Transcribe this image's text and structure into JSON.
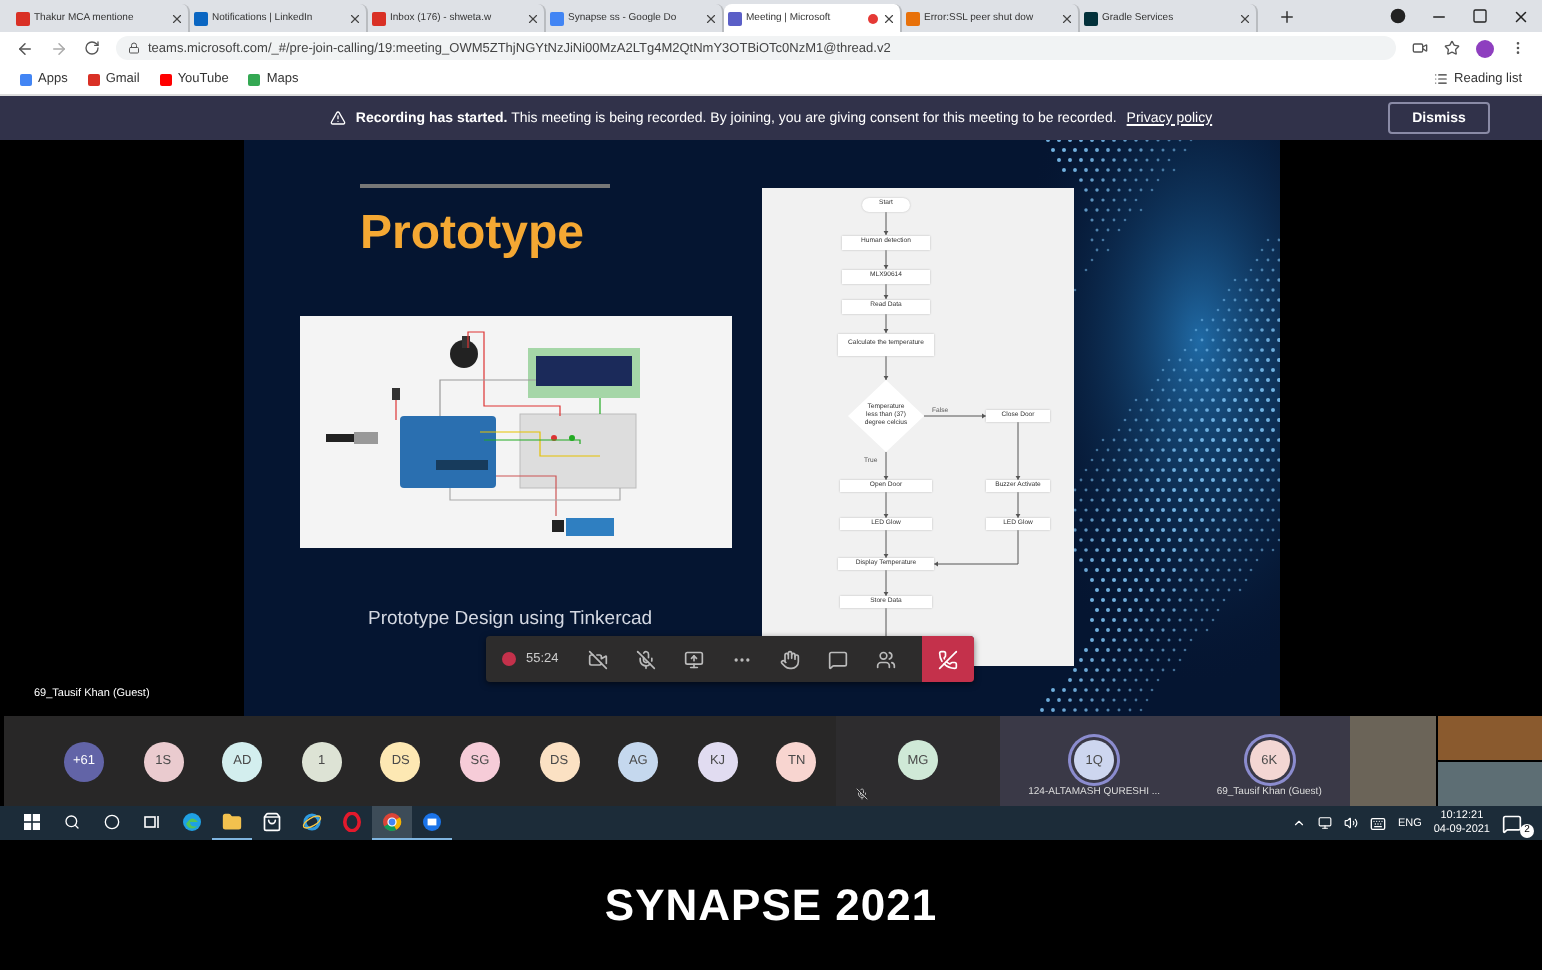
{
  "browser": {
    "tabs": [
      {
        "kind": "gmail",
        "title": "Thakur MCA mentione",
        "selected": false
      },
      {
        "kind": "linkedin",
        "title": "Notifications | LinkedIn",
        "selected": false
      },
      {
        "kind": "gmail",
        "title": "Inbox (176) - shweta.w",
        "selected": false
      },
      {
        "kind": "docs",
        "title": "Synapse ss - Google Do",
        "selected": false
      },
      {
        "kind": "teams",
        "title": "Meeting | Microsoft",
        "selected": true,
        "recording": true
      },
      {
        "kind": "error",
        "title": "Error:SSL peer shut dow",
        "selected": false
      },
      {
        "kind": "gradle",
        "title": "Gradle Services",
        "selected": false
      }
    ],
    "address": "teams.microsoft.com/_#/pre-join-calling/19:meeting_OWM5ZThjNGYtNzJiNi00MzA2LTg4M2QtNmY3OTBiOTc0NzM1@thread.v2",
    "bookmarks": [
      {
        "kind": "apps",
        "label": "Apps"
      },
      {
        "kind": "gmail",
        "label": "Gmail"
      },
      {
        "kind": "youtube",
        "label": "YouTube"
      },
      {
        "kind": "maps",
        "label": "Maps"
      }
    ],
    "reading_list": "Reading list"
  },
  "banner": {
    "text": "**Recording has started.** This meeting is being recorded. By joining, you are giving consent for this meeting to be recorded.",
    "link": "Privacy policy",
    "button": "Dismiss"
  },
  "slide": {
    "title": "Prototype",
    "caption": "Prototype Design using Tinkercad",
    "flowchart": {
      "nodes": [
        {
          "kind": "terminal",
          "label": "Start"
        },
        {
          "kind": "process",
          "label": "Human detection"
        },
        {
          "kind": "process",
          "label": "MLX90614"
        },
        {
          "kind": "process",
          "label": "Read Data"
        },
        {
          "kind": "process",
          "label": "Calculate the temperature"
        },
        {
          "kind": "decision",
          "label": "Temperature less than (37) degree celcius"
        },
        {
          "kind": "process",
          "label": "Close Door"
        },
        {
          "kind": "process",
          "label": "Open Door"
        },
        {
          "kind": "process",
          "label": "Buzzer Activate"
        },
        {
          "kind": "process",
          "label": "LED Glow"
        },
        {
          "kind": "process",
          "label": "LED Glow"
        },
        {
          "kind": "process",
          "label": "Display Temperature"
        },
        {
          "kind": "process",
          "label": "Store Data"
        }
      ],
      "edge_labels": [
        "False",
        "True"
      ]
    }
  },
  "presenter_label": "69_Tausif Khan (Guest)",
  "call_controls": {
    "recording": true,
    "timer": "55:24"
  },
  "participants": [
    {
      "kind": "overflow",
      "initials": "+61",
      "color": "#6264a7"
    },
    {
      "kind": "person",
      "initials": "1S",
      "color": "#eacbcf"
    },
    {
      "kind": "person",
      "initials": "AD",
      "color": "#d3eeee"
    },
    {
      "kind": "person",
      "initials": "1",
      "color": "#dde3d5"
    },
    {
      "kind": "person",
      "initials": "DS",
      "color": "#fde8b3"
    },
    {
      "kind": "person",
      "initials": "SG",
      "color": "#f6ccd8"
    },
    {
      "kind": "person",
      "initials": "DS",
      "color": "#fbe1c3"
    },
    {
      "kind": "person",
      "initials": "AG",
      "color": "#c5d8ee"
    },
    {
      "kind": "person",
      "initials": "KJ",
      "color": "#e1dcf1"
    },
    {
      "kind": "person",
      "initials": "TN",
      "color": "#f8d5d0"
    }
  ],
  "featured": {
    "initials": "MG",
    "color": "#cfe9d7",
    "muted": true
  },
  "named_tiles": [
    {
      "initials": "1Q",
      "name": "124-ALTAMASH QURESHI ...",
      "color": "#cdd6ef"
    },
    {
      "initials": "6K",
      "name": "69_Tausif Khan (Guest)",
      "color": "#f3d6d3"
    }
  ],
  "taskbar": {
    "apps": [
      {
        "kind": "edge",
        "selected": false,
        "running": false
      },
      {
        "kind": "explorer",
        "selected": false,
        "running": true
      },
      {
        "kind": "store",
        "selected": false,
        "running": false
      },
      {
        "kind": "ie",
        "selected": false,
        "running": false
      },
      {
        "kind": "opera",
        "selected": false,
        "running": false
      },
      {
        "kind": "chrome",
        "selected": true,
        "running": true
      },
      {
        "kind": "files",
        "selected": false,
        "running": true
      }
    ],
    "language": "ENG",
    "time": "10:12:21",
    "date": "04-09-2021",
    "notifications": "2"
  },
  "caption": "SYNAPSE 2021"
}
